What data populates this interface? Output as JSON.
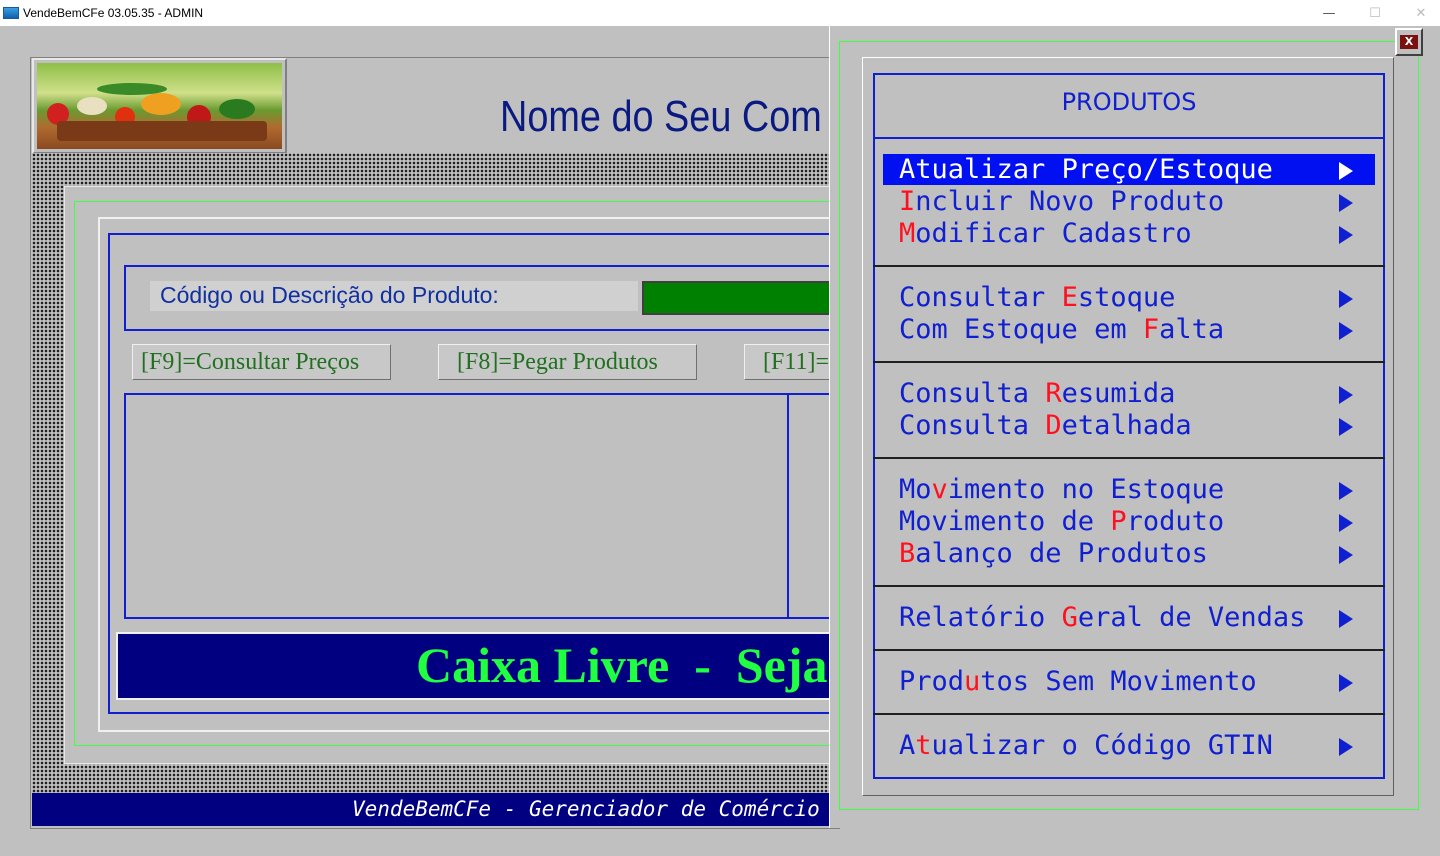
{
  "window": {
    "title": "VendeBemCFe 03.05.35 - ADMIN",
    "minimize_glyph": "—",
    "maximize_glyph": "☐",
    "close_glyph": "✕"
  },
  "header": {
    "company_name": "Nome do Seu Com"
  },
  "search": {
    "label": "Código ou Descrição do Produto:"
  },
  "function_keys": [
    {
      "label": "[F9]=Consultar Preços"
    },
    {
      "label": "[F8]=Pegar Produtos"
    },
    {
      "label": "[F11]="
    }
  ],
  "status": {
    "text": "Caixa Livre  -  Seja B"
  },
  "footer": {
    "text": "VendeBemCFe - Gerenciador de Comércio"
  },
  "popup": {
    "close_label": "X",
    "title": "PRODUTOS",
    "items": [
      {
        "pre": "",
        "hotkey": "A",
        "post": "tualizar Preço/Estoque",
        "selected": true
      },
      {
        "pre": "",
        "hotkey": "I",
        "post": "ncluir Novo Produto"
      },
      {
        "pre": "",
        "hotkey": "M",
        "post": "odificar Cadastro"
      },
      {
        "pre": "Consultar ",
        "hotkey": "E",
        "post": "stoque"
      },
      {
        "pre": "Com Estoque em ",
        "hotkey": "F",
        "post": "alta"
      },
      {
        "pre": "Consulta ",
        "hotkey": "R",
        "post": "esumida"
      },
      {
        "pre": "Consulta ",
        "hotkey": "D",
        "post": "etalhada"
      },
      {
        "pre": "Mo",
        "hotkey": "v",
        "post": "imento no Estoque"
      },
      {
        "pre": "Movimento de ",
        "hotkey": "P",
        "post": "roduto"
      },
      {
        "pre": "",
        "hotkey": "B",
        "post": "alanço de Produtos"
      },
      {
        "pre": "Relatório ",
        "hotkey": "G",
        "post": "eral de Vendas"
      },
      {
        "pre": "Prod",
        "hotkey": "u",
        "post": "tos Sem Movimento"
      },
      {
        "pre": "A",
        "hotkey": "t",
        "post": "ualizar o Código GTIN"
      }
    ]
  },
  "colors": {
    "menu_text": "#1020d0",
    "hotkey": "#ff1020",
    "selected_bg": "#0010f0",
    "status_bg": "#000080",
    "status_text": "#20ff40"
  }
}
